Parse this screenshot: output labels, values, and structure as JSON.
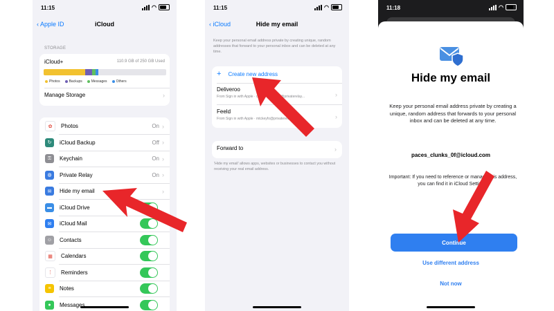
{
  "screen1": {
    "time": "11:15",
    "back_label": "Apple ID",
    "title": "iCloud",
    "storage_label": "STORAGE",
    "plan_name": "iCloud+",
    "storage_used": "110.9 GB of 250 GB Used",
    "legend": [
      {
        "label": "Photos",
        "color": "#f2c230"
      },
      {
        "label": "Backups",
        "color": "#6f5fb5"
      },
      {
        "label": "Messages",
        "color": "#5fbf5f"
      },
      {
        "label": "Others",
        "color": "#3a8ee6"
      }
    ],
    "manage_storage": "Manage Storage",
    "apps": [
      {
        "label": "Photos",
        "value": "On",
        "control": "chevron",
        "icon": "photos-icon",
        "color": "#ffffff",
        "glyph": "✿"
      },
      {
        "label": "iCloud Backup",
        "value": "Off",
        "control": "chevron",
        "icon": "backup-icon",
        "color": "#2d8a7a",
        "glyph": "↻"
      },
      {
        "label": "Keychain",
        "value": "On",
        "control": "chevron",
        "icon": "key-icon",
        "color": "#8e8e93",
        "glyph": "⚿"
      },
      {
        "label": "Private Relay",
        "value": "On",
        "control": "chevron",
        "icon": "globe-icon",
        "color": "#3a7be0",
        "glyph": "◍"
      },
      {
        "label": "Hide my email",
        "value": "",
        "control": "chevron",
        "icon": "mail-shield-icon",
        "color": "#3a7be0",
        "glyph": "✉"
      },
      {
        "label": "iCloud Drive",
        "value": "",
        "control": "toggle",
        "icon": "folder-icon",
        "color": "#3a8ee6",
        "glyph": "▬"
      },
      {
        "label": "iCloud Mail",
        "value": "",
        "control": "toggle",
        "icon": "mail-icon",
        "color": "#2f7ff0",
        "glyph": "✉"
      },
      {
        "label": "Contacts",
        "value": "",
        "control": "toggle",
        "icon": "contacts-icon",
        "color": "#a0a0a5",
        "glyph": "☺"
      },
      {
        "label": "Calendars",
        "value": "",
        "control": "toggle",
        "icon": "calendar-icon",
        "color": "#ffffff",
        "glyph": "▦"
      },
      {
        "label": "Reminders",
        "value": "",
        "control": "toggle",
        "icon": "reminders-icon",
        "color": "#ffffff",
        "glyph": "⋮"
      },
      {
        "label": "Notes",
        "value": "",
        "control": "toggle",
        "icon": "notes-icon",
        "color": "#f5c400",
        "glyph": "≡"
      },
      {
        "label": "Messages",
        "value": "",
        "control": "toggle",
        "icon": "messages-icon",
        "color": "#34c759",
        "glyph": "●"
      }
    ]
  },
  "screen2": {
    "time": "11:15",
    "back_label": "iCloud",
    "title": "Hide my email",
    "intro": "Keep your personal email address private by creating unique, random addresses that forward to your personal inbox and can be deleted at any time.",
    "create_label": "Create new address",
    "entries": [
      {
        "name": "Deliveroo",
        "detail": "From Sign in with Apple · deliveroo.admin@privaterelay..."
      },
      {
        "name": "Feeld",
        "detail": "From Sign in with Apple · mtckeyfo@privaterelay..."
      }
    ],
    "forward_label": "Forward to",
    "footer": "'Hide my email' allows apps, websites or businesses to contact you without receiving your real email address."
  },
  "screen3": {
    "time": "11:18",
    "title": "Hide my email",
    "description": "Keep your personal email address private by creating a unique, random address that forwards to your personal inbox and can be deleted at any time.",
    "address": "paces_clunks_0f@icloud.com",
    "important": "Important: If you need to reference or manage this address, you can find it in iCloud Settings.",
    "continue_label": "Continue",
    "use_different_label": "Use different address",
    "not_now_label": "Not now",
    "accent": "#2f7ff0"
  },
  "annotation_color": "#e8262a"
}
